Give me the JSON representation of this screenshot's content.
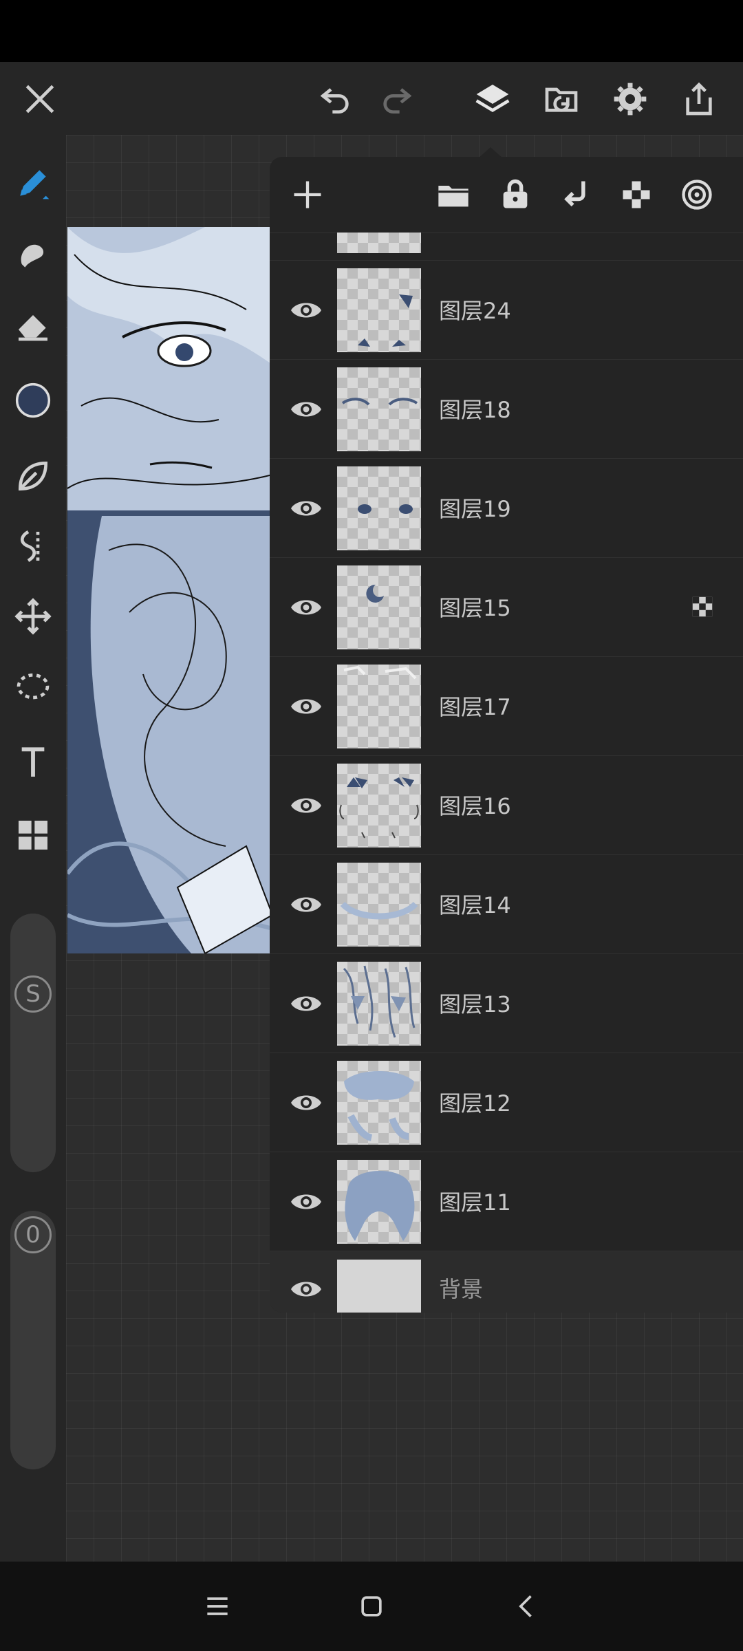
{
  "layers_panel": {
    "layers": [
      {
        "name": "图层24"
      },
      {
        "name": "图层18"
      },
      {
        "name": "图层19"
      },
      {
        "name": "图层15",
        "alpha_locked": true
      },
      {
        "name": "图层17"
      },
      {
        "name": "图层16"
      },
      {
        "name": "图层14"
      },
      {
        "name": "图层13"
      },
      {
        "name": "图层12"
      },
      {
        "name": "图层11"
      }
    ],
    "background": {
      "name": "背景"
    }
  },
  "sidebar": {
    "size_slider_label": "S",
    "opacity_slider_label": "0"
  },
  "colors": {
    "current_color": "#2f3d5a",
    "accent": "#2a8fd8"
  }
}
